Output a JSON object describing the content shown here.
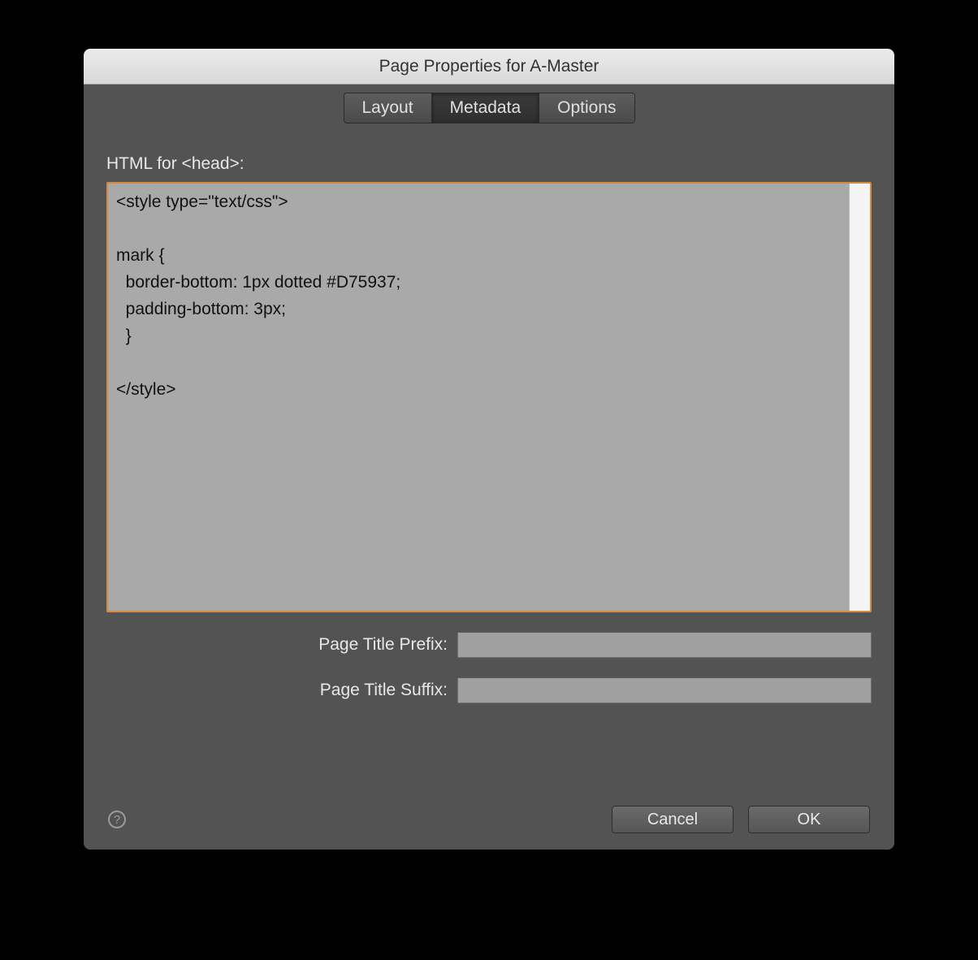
{
  "titlebar": {
    "title": "Page Properties for A-Master"
  },
  "tabs": {
    "layout": "Layout",
    "metadata": "Metadata",
    "options": "Options"
  },
  "head_section": {
    "label": "HTML for <head>:",
    "value": "<style type=\"text/css\">\n\nmark {\n  border-bottom: 1px dotted #D75937;\n  padding-bottom: 3px;\n  }\n\n</style>"
  },
  "prefix": {
    "label": "Page Title Prefix:",
    "value": ""
  },
  "suffix": {
    "label": "Page Title Suffix:",
    "value": ""
  },
  "buttons": {
    "cancel": "Cancel",
    "ok": "OK"
  },
  "help_glyph": "?"
}
